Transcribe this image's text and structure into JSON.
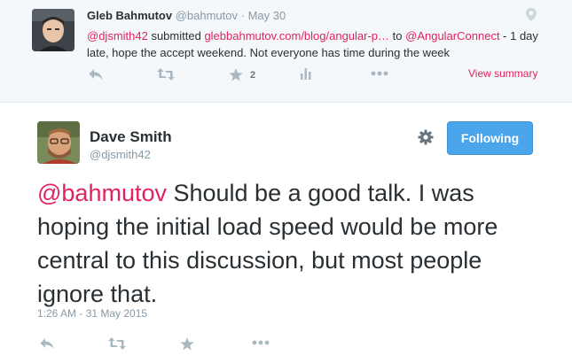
{
  "parent_tweet": {
    "author_name": "Gleb Bahmutov",
    "author_handle": "@bahmutov",
    "separator": "·",
    "date": "May 30",
    "mention": "@djsmith42",
    "text_submitted": " submitted ",
    "link": "glebbahmutov.com/blog/angular-p…",
    "text_to": " to ",
    "mention2": "@AngularConnect",
    "text_rest": " - 1 day late, hope the accept weekend. Not everyone has time during the week",
    "favorite_count": "2",
    "view_summary": "View summary"
  },
  "main_tweet": {
    "author_name": "Dave Smith",
    "author_handle": "@djsmith42",
    "follow_label": "Following",
    "mention": "@bahmutov",
    "text": " Should be a good talk. I was hoping the initial load speed would be more central to this discussion, but most people ignore that.",
    "timestamp": "1:26 AM - 31 May 2015"
  },
  "colors": {
    "link": "#e0245e",
    "follow_button": "#4aa5ea",
    "muted_text": "#8899a6",
    "icon": "#aab8c2",
    "parent_background": "#f5f8fa"
  },
  "icons": {
    "parent_actions": [
      "reply-icon",
      "retweet-icon",
      "favorite-star-icon",
      "analytics-icon",
      "more-icon"
    ],
    "main_actions": [
      "reply-icon",
      "retweet-icon",
      "favorite-star-icon",
      "more-icon"
    ],
    "other": [
      "location-pin-icon",
      "gear-icon"
    ]
  }
}
